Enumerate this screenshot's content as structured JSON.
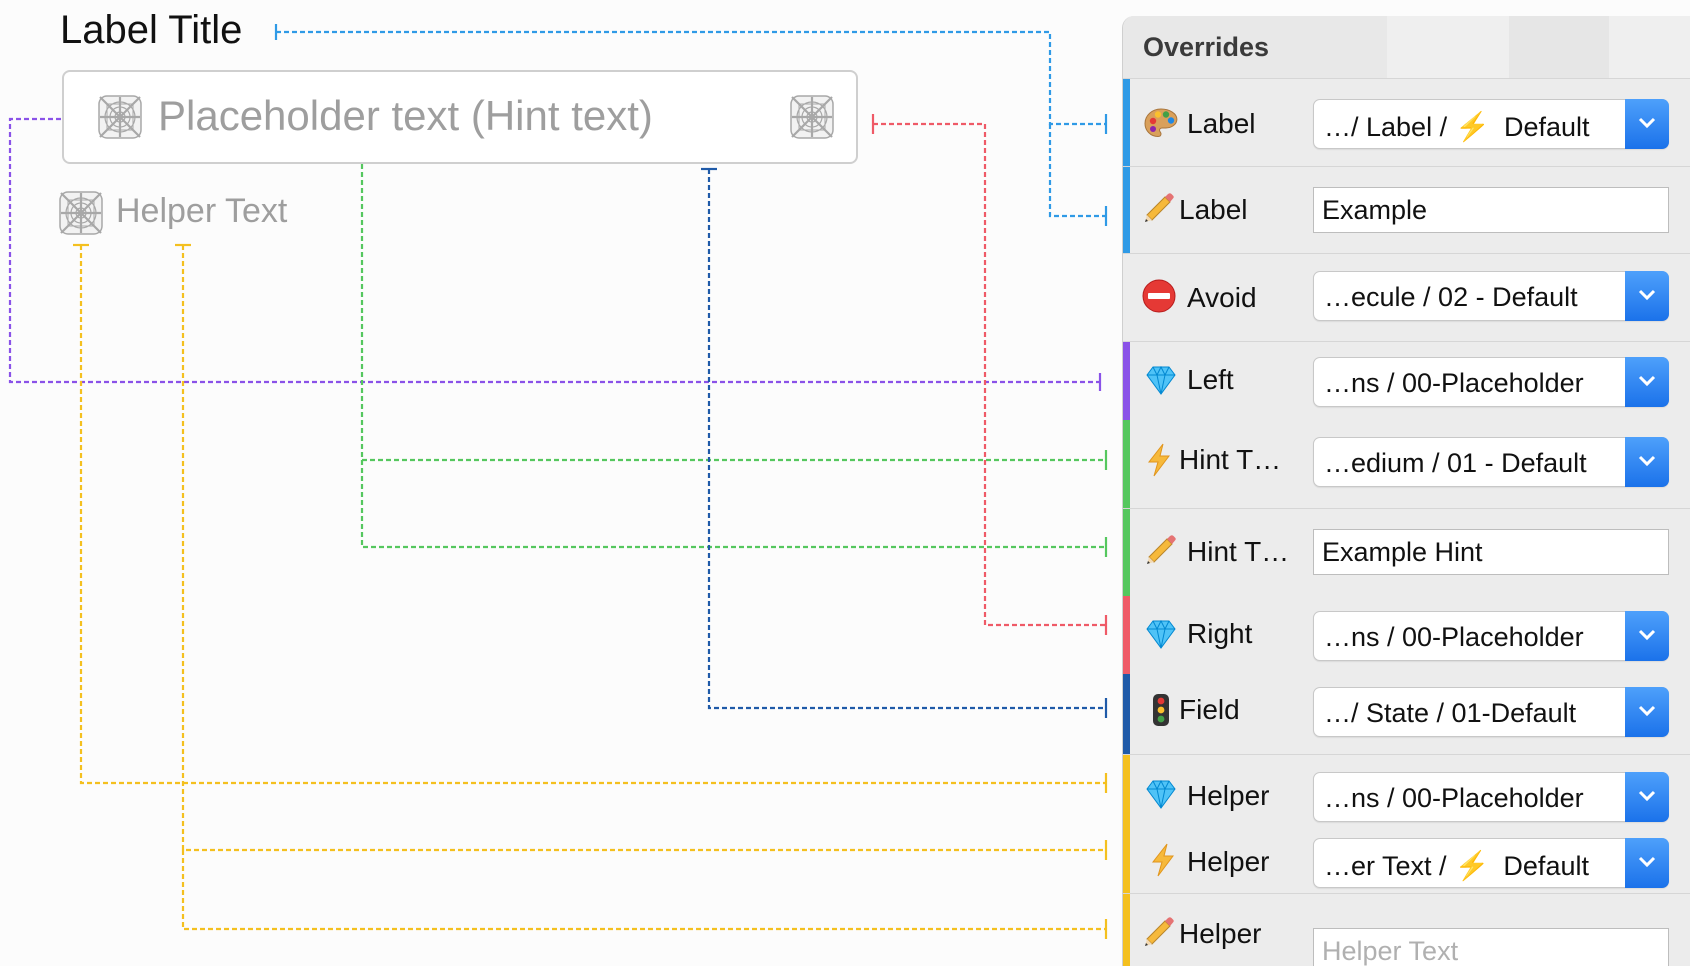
{
  "preview": {
    "label_title": "Label Title",
    "placeholder": "Placeholder text (Hint text)",
    "helper": "Helper Text"
  },
  "panel": {
    "title": "Overrides",
    "rows": [
      {
        "icon": "palette-icon",
        "label": "Label",
        "value": "…/ Label /",
        "value_bolt": "⚡",
        "value_suffix": "Default"
      },
      {
        "icon": "pencil-icon",
        "label": "Label",
        "value": "Example"
      },
      {
        "icon": "no-entry-icon",
        "label": "Avoid",
        "value": "…ecule / 02 - Default"
      },
      {
        "icon": "gem-icon",
        "label": "Left",
        "value": "…ns / 00-Placeholder"
      },
      {
        "icon": "bolt-icon",
        "label": "Hint T…",
        "value": "…edium / 01 - Default"
      },
      {
        "icon": "pencil-icon",
        "label": "Hint T…",
        "value": "Example Hint"
      },
      {
        "icon": "gem-icon",
        "label": "Right",
        "value": "…ns / 00-Placeholder"
      },
      {
        "icon": "traffic-light-icon",
        "label": "Field",
        "value": "…/ State / 01-Default"
      },
      {
        "icon": "gem-icon",
        "label": "Helper",
        "value": "…ns / 00-Placeholder"
      },
      {
        "icon": "bolt-icon",
        "label": "Helper",
        "value": "…er Text /",
        "value_bolt": "⚡",
        "value_suffix": "Default"
      },
      {
        "icon": "pencil-icon",
        "label": "Helper",
        "placeholder": "Helper Text"
      }
    ]
  },
  "colors": {
    "label": "#2f9ae6",
    "left": "#8a52e8",
    "hint": "#55c75e",
    "right": "#ef5a67",
    "field": "#1f5aa8",
    "helper": "#f4c01f",
    "accent": "#1b72ea"
  }
}
